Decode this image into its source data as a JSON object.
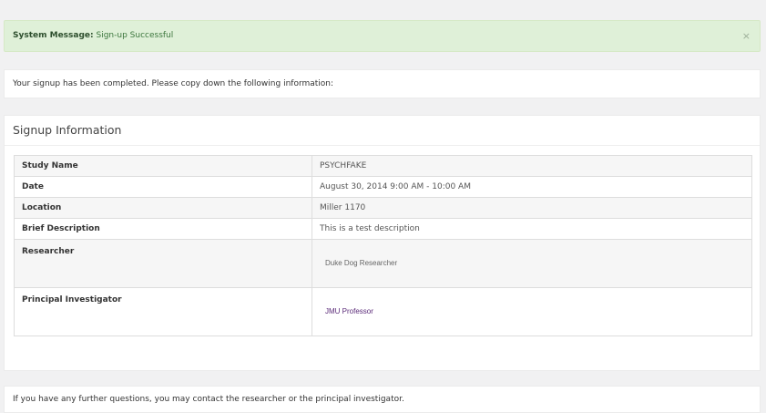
{
  "alert": {
    "label": "System Message:",
    "text": "Sign-up Successful",
    "close": "×"
  },
  "message": "Your signup has been completed. Please copy down the following information:",
  "info": {
    "heading": "Signup Information",
    "rows": [
      {
        "key": "Study Name",
        "value": "PSYCHFAKE"
      },
      {
        "key": "Date",
        "value": "August 30, 2014 9:00 AM - 10:00 AM"
      },
      {
        "key": "Location",
        "value": "Miller 1170"
      },
      {
        "key": "Brief Description",
        "value": "This is a test description"
      },
      {
        "key": "Researcher",
        "value": "Duke Dog Researcher"
      },
      {
        "key": "Principal Investigator",
        "value": "JMU Professor"
      }
    ]
  },
  "footer": "If you have any further questions, you may contact the researcher or the principal investigator.",
  "colors": {
    "alert_bg": "#dff0d8",
    "link": "#5a2a78"
  }
}
